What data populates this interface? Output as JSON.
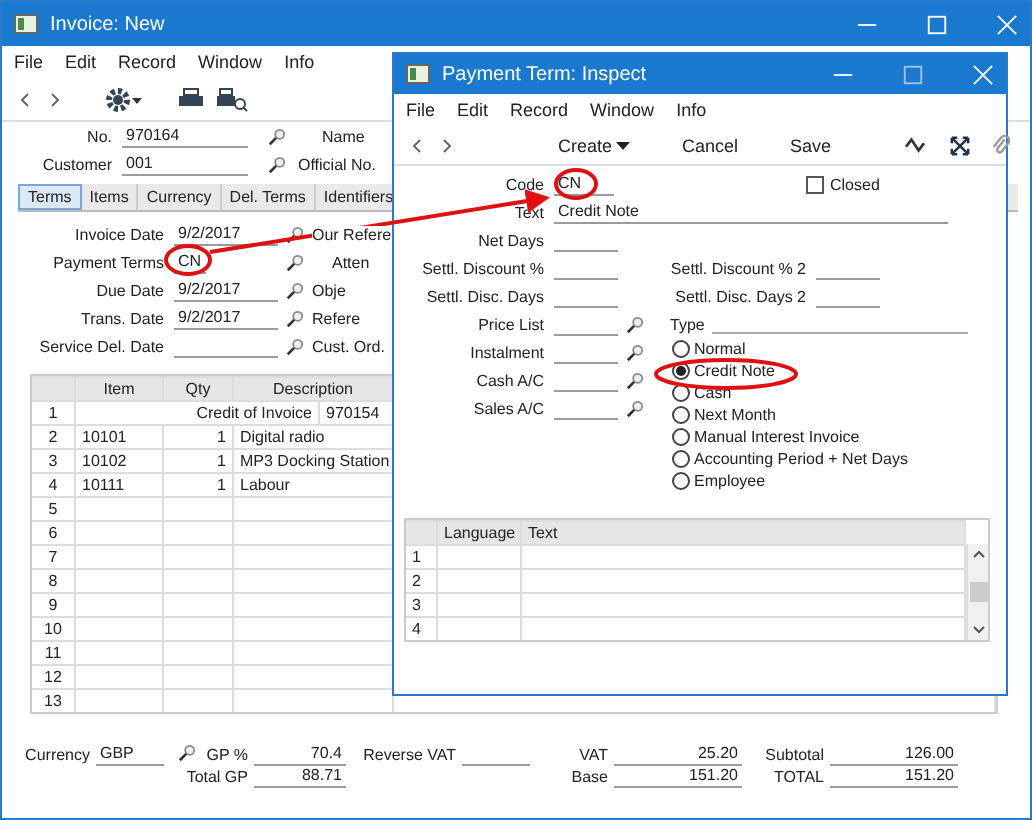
{
  "window": {
    "title": "Invoice: New"
  },
  "menu": [
    "File",
    "Edit",
    "Record",
    "Window",
    "Info"
  ],
  "header": {
    "number": {
      "label": "No.",
      "value": "970164"
    },
    "customer": {
      "label": "Customer",
      "value": "001"
    },
    "name_label": "Name",
    "official_label": "Official No."
  },
  "tabs": [
    {
      "label": "Terms",
      "selected": true
    },
    {
      "label": "Items",
      "selected": false
    },
    {
      "label": "Currency",
      "selected": false
    },
    {
      "label": "Del. Terms",
      "selected": false
    },
    {
      "label": "Identifiers",
      "selected": false
    }
  ],
  "terms_fields": [
    {
      "label": "Invoice Date",
      "value": "9/2/2017",
      "side_label": "Our Refere"
    },
    {
      "label": "Payment Terms",
      "value": "CN",
      "side_label": "Atten"
    },
    {
      "label": "Due Date",
      "value": "9/2/2017",
      "side_label": "Obje"
    },
    {
      "label": "Trans. Date",
      "value": "9/2/2017",
      "side_label": "Refere"
    },
    {
      "label": "Service Del. Date",
      "side_label": "Cust. Ord."
    }
  ],
  "table": {
    "columns": [
      "Item",
      "Qty",
      "Description"
    ],
    "rows": [
      {
        "number": "1",
        "kind": "text",
        "text": "Credit of Invoice",
        "reference": "970154"
      },
      {
        "number": "2",
        "kind": "item",
        "item": "10101",
        "qty": "1",
        "description": "Digital radio"
      },
      {
        "number": "3",
        "kind": "item",
        "item": "10102",
        "qty": "1",
        "description": "MP3 Docking Station"
      },
      {
        "number": "4",
        "kind": "item",
        "item": "10111",
        "qty": "1",
        "description": "Labour"
      },
      {
        "number": "5",
        "kind": "empty"
      },
      {
        "number": "6",
        "kind": "empty"
      },
      {
        "number": "7",
        "kind": "empty"
      },
      {
        "number": "8",
        "kind": "empty"
      },
      {
        "number": "9",
        "kind": "empty"
      },
      {
        "number": "10",
        "kind": "empty"
      },
      {
        "number": "11",
        "kind": "empty"
      },
      {
        "number": "12",
        "kind": "empty"
      },
      {
        "number": "13",
        "kind": "empty"
      }
    ]
  },
  "footer": {
    "currency": {
      "label": "Currency",
      "value": "GBP"
    },
    "gp_percent": {
      "label": "GP %",
      "value": "70.4"
    },
    "reverse_vat": {
      "label": "Reverse VAT"
    },
    "vat": {
      "label": "VAT",
      "value": "25.20"
    },
    "subtotal": {
      "label": "Subtotal",
      "value": "126.00"
    },
    "total_gp": {
      "label": "Total GP",
      "value": "88.71"
    },
    "base": {
      "label": "Base",
      "value": "151.20"
    },
    "total": {
      "label": "TOTAL",
      "value": "151.20"
    }
  },
  "dialog": {
    "title": "Payment Term: Inspect",
    "menu": [
      "File",
      "Edit",
      "Record",
      "Window",
      "Info"
    ],
    "toolbar": [
      {
        "label": "Create",
        "dropdown": true
      },
      {
        "label": "Cancel",
        "dropdown": false
      },
      {
        "label": "Save",
        "dropdown": false
      }
    ],
    "code": {
      "label": "Code",
      "value": "CN"
    },
    "closed": {
      "label": "Closed",
      "checked": false
    },
    "text": {
      "label": "Text",
      "value": "Credit Note"
    },
    "left_fields": [
      {
        "label": "Net Days",
        "lookup": false
      },
      {
        "label": "Settl. Discount %",
        "lookup": false
      },
      {
        "label": "Settl. Disc. Days",
        "lookup": false
      },
      {
        "label": "Price List",
        "lookup": true
      },
      {
        "label": "Instalment",
        "lookup": true
      },
      {
        "label": "Cash A/C",
        "lookup": true
      },
      {
        "label": "Sales A/C",
        "lookup": true
      }
    ],
    "right_fields": [
      {
        "label": "Settl. Discount % 2"
      },
      {
        "label": "Settl. Disc. Days 2"
      }
    ],
    "type": {
      "label": "Type",
      "options": [
        {
          "label": "Normal",
          "selected": false
        },
        {
          "label": "Credit Note",
          "selected": true
        },
        {
          "label": "Cash",
          "selected": false
        },
        {
          "label": "Next Month",
          "selected": false
        },
        {
          "label": "Manual Interest Invoice",
          "selected": false
        },
        {
          "label": "Accounting Period + Net Days",
          "selected": false
        },
        {
          "label": "Employee",
          "selected": false
        }
      ]
    },
    "grid": {
      "columns": [
        "Language",
        "Text"
      ],
      "rows": [
        "1",
        "2",
        "3",
        "4"
      ]
    }
  }
}
